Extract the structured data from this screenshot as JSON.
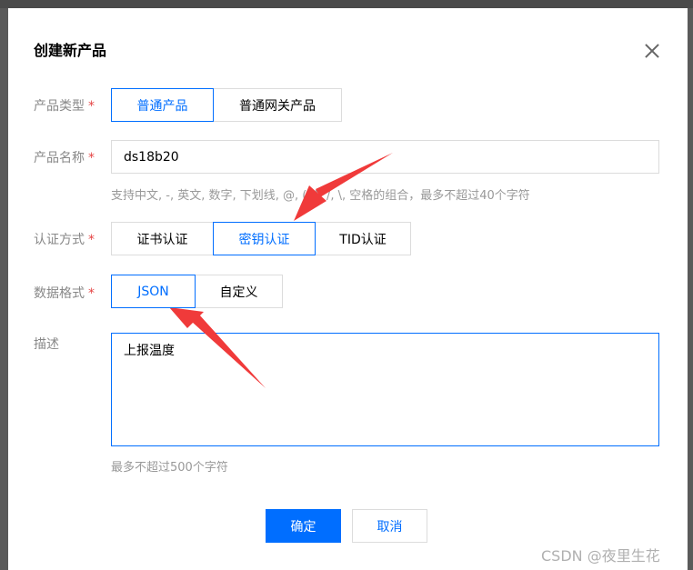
{
  "dialog": {
    "title": "创建新产品",
    "close_icon": "close-icon"
  },
  "fields": {
    "product_type": {
      "label": "产品类型",
      "required": "*",
      "options": [
        "普通产品",
        "普通网关产品"
      ],
      "selected": "普通产品"
    },
    "product_name": {
      "label": "产品名称",
      "required": "*",
      "value": "ds18b20",
      "hint": "支持中文, -, 英文, 数字, 下划线, @, (, ), /, \\, 空格的组合，最多不超过40个字符"
    },
    "auth_method": {
      "label": "认证方式",
      "required": "*",
      "options": [
        "证书认证",
        "密钥认证",
        "TID认证"
      ],
      "selected": "密钥认证"
    },
    "data_format": {
      "label": "数据格式",
      "required": "*",
      "options": [
        "JSON",
        "自定义"
      ],
      "selected": "JSON"
    },
    "description": {
      "label": "描述",
      "value": "上报温度",
      "hint": "最多不超过500个字符"
    }
  },
  "buttons": {
    "confirm": "确定",
    "cancel": "取消"
  },
  "watermark": "CSDN @夜里生花",
  "colors": {
    "accent": "#006eff",
    "required": "#e54545",
    "annotation_arrow": "#f03a3a"
  }
}
